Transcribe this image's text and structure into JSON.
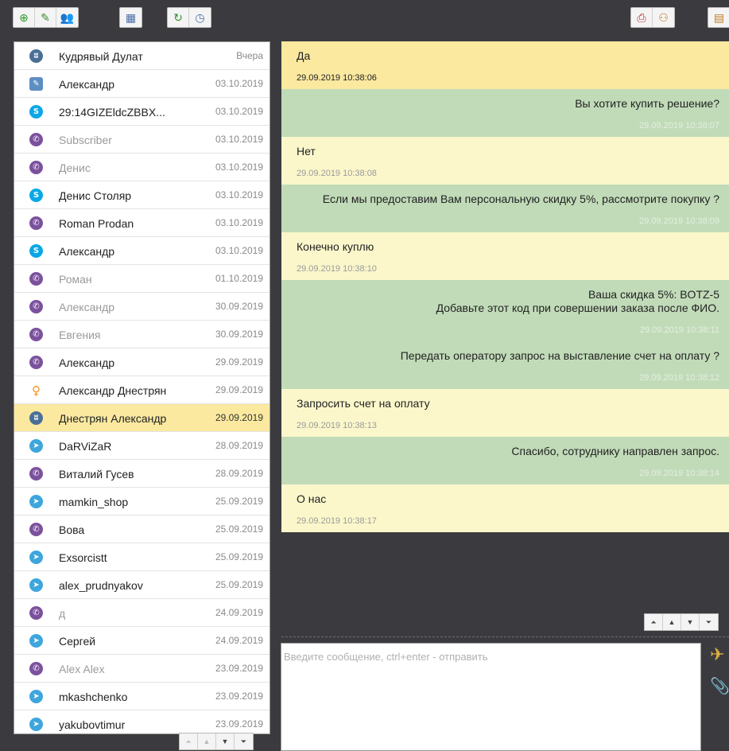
{
  "toolbar": {
    "group1": [
      {
        "name": "add-contact-button",
        "icon": "add-icon",
        "glyph": "⊕",
        "color": "#2a9a2a"
      },
      {
        "name": "edit-button",
        "icon": "pencil-icon",
        "glyph": "✎",
        "color": "#3d8b2e"
      },
      {
        "name": "users-button",
        "icon": "users-icon",
        "glyph": "👥",
        "color": "#c07a20"
      }
    ],
    "group2": [
      {
        "name": "report-button",
        "icon": "report-icon",
        "glyph": "▦",
        "color": "#4a6ea8"
      }
    ],
    "group3": [
      {
        "name": "refresh-button",
        "icon": "refresh-icon",
        "glyph": "↻",
        "color": "#2f8f2f"
      },
      {
        "name": "history-button",
        "icon": "clock-icon",
        "glyph": "◷",
        "color": "#4a6ea8"
      }
    ],
    "group4": [
      {
        "name": "print-button",
        "icon": "printer-icon",
        "glyph": "⎙",
        "color": "#c8282d"
      },
      {
        "name": "transfer-button",
        "icon": "user-transfer-icon",
        "glyph": "⚇",
        "color": "#c07a20"
      }
    ],
    "group5": [
      {
        "name": "chart-button",
        "icon": "chart-icon",
        "glyph": "▤",
        "color": "#c07a20"
      }
    ]
  },
  "contacts": [
    {
      "name": "Кудрявый Дулат",
      "date": "Вчера",
      "channel": "vk",
      "muted": false
    },
    {
      "name": "Александр",
      "date": "03.10.2019",
      "channel": "vkc",
      "muted": false
    },
    {
      "name": "29:14GIZEldcZBBX...",
      "date": "03.10.2019",
      "channel": "skype",
      "muted": false
    },
    {
      "name": "Subscriber",
      "date": "03.10.2019",
      "channel": "viber",
      "muted": true
    },
    {
      "name": "Денис",
      "date": "03.10.2019",
      "channel": "viber",
      "muted": true
    },
    {
      "name": "Денис Столяр",
      "date": "03.10.2019",
      "channel": "skype",
      "muted": false
    },
    {
      "name": "Roman  Prodan",
      "date": "03.10.2019",
      "channel": "viber",
      "muted": false
    },
    {
      "name": "Александр",
      "date": "03.10.2019",
      "channel": "skype",
      "muted": false
    },
    {
      "name": "Роман",
      "date": "01.10.2019",
      "channel": "viber",
      "muted": true
    },
    {
      "name": "Александр",
      "date": "30.09.2019",
      "channel": "viber",
      "muted": true
    },
    {
      "name": "Евгения",
      "date": "30.09.2019",
      "channel": "viber",
      "muted": true
    },
    {
      "name": "Александр",
      "date": "29.09.2019",
      "channel": "viber",
      "muted": false
    },
    {
      "name": "Александр Днестрян",
      "date": "29.09.2019",
      "channel": "ok",
      "muted": false
    },
    {
      "name": "Днестрян Александр",
      "date": "29.09.2019",
      "channel": "vk",
      "muted": false,
      "selected": true
    },
    {
      "name": "DaRViZaR",
      "date": "28.09.2019",
      "channel": "tg",
      "muted": false
    },
    {
      "name": "Виталий Гусев",
      "date": "28.09.2019",
      "channel": "viber",
      "muted": false
    },
    {
      "name": "mamkin_shop",
      "date": "25.09.2019",
      "channel": "tg",
      "muted": false
    },
    {
      "name": "Вова",
      "date": "25.09.2019",
      "channel": "viber",
      "muted": false
    },
    {
      "name": "Exsorcistt",
      "date": "25.09.2019",
      "channel": "tg",
      "muted": false
    },
    {
      "name": "alex_prudnyakov",
      "date": "25.09.2019",
      "channel": "tg",
      "muted": false
    },
    {
      "name": "д",
      "date": "24.09.2019",
      "channel": "viber",
      "muted": true
    },
    {
      "name": "Сергей",
      "date": "24.09.2019",
      "channel": "tg",
      "muted": false
    },
    {
      "name": "Alex  Alex",
      "date": "23.09.2019",
      "channel": "viber",
      "muted": true
    },
    {
      "name": "mkashchenko",
      "date": "23.09.2019",
      "channel": "tg",
      "muted": false
    },
    {
      "name": "yakubovtimur",
      "date": "23.09.2019",
      "channel": "tg",
      "muted": false
    }
  ],
  "messages": [
    {
      "dir": "in",
      "first": true,
      "text": "Да",
      "time": "29.09.2019 10:38:06"
    },
    {
      "dir": "out",
      "text": "Вы хотите купить решение?",
      "time": "29.09.2019 10:38:07"
    },
    {
      "dir": "in",
      "text": "Нет",
      "time": "29.09.2019 10:38:08"
    },
    {
      "dir": "out",
      "text": "Если мы предоставим Вам персональную скидку 5%, рассмотрите покупку ?",
      "time": "29.09.2019 10:38:09"
    },
    {
      "dir": "in",
      "text": "Конечно куплю",
      "time": "29.09.2019 10:38:10"
    },
    {
      "dir": "out",
      "text": "Ваша скидка 5%: BOTZ-5\nДобавьте этот код при совершении заказа после ФИО.",
      "time": "29.09.2019 10:38:11"
    },
    {
      "dir": "out",
      "text": "Передать оператору запрос на выставление счет на оплату ?",
      "time": "29.09.2019 10:38:12"
    },
    {
      "dir": "in",
      "text": "Запросить счет на оплату",
      "time": "29.09.2019 10:38:13"
    },
    {
      "dir": "out",
      "text": "Спасибо, сотруднику направлен запрос.",
      "time": "29.09.2019 10:38:14"
    },
    {
      "dir": "in",
      "text": "О нас",
      "time": "29.09.2019 10:38:17"
    }
  ],
  "icons": {
    "vk": "vk-icon",
    "vkc": "vk-community-icon",
    "skype": "skype-icon",
    "viber": "viber-icon",
    "tg": "telegram-icon",
    "ok": "odnoklassniki-icon"
  },
  "glyphs": {
    "vk": "ʬ",
    "vkc": "✎",
    "skype": "S",
    "viber": "✆",
    "tg": "➤",
    "ok": "♀"
  },
  "nav": {
    "first": "⏶",
    "up": "▲",
    "down": "▼",
    "last": "⏷"
  },
  "composer": {
    "placeholder": "Введите сообщение, ctrl+enter - отправить",
    "send_glyph": "✈",
    "attach_glyph": "📎"
  }
}
